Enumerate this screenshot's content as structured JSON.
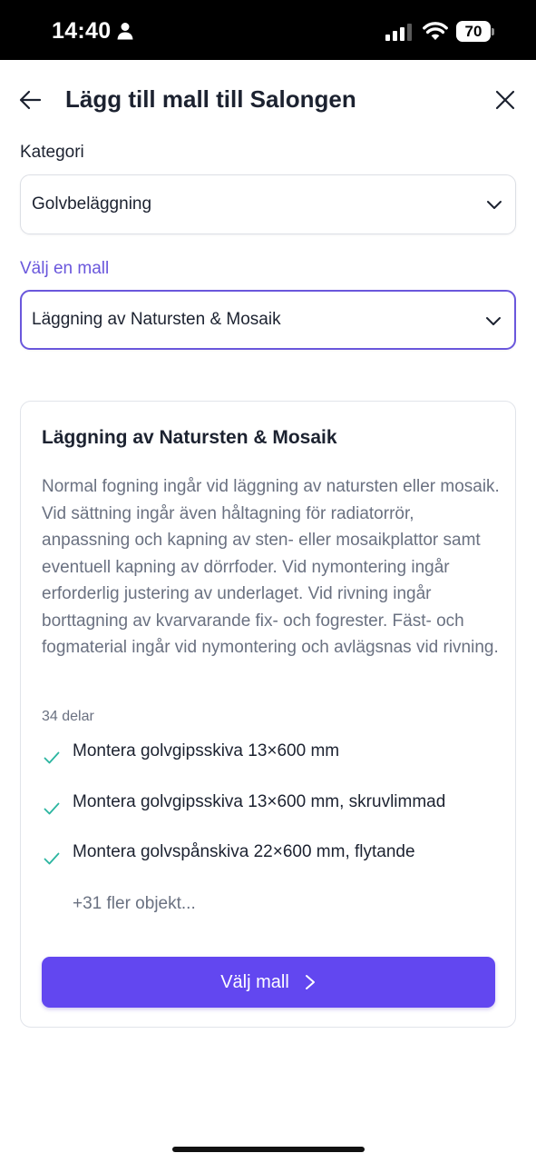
{
  "status_bar": {
    "time": "14:40",
    "battery": "70"
  },
  "header": {
    "title": "Lägg till mall till Salongen"
  },
  "category": {
    "label": "Kategori",
    "value": "Golvbeläggning"
  },
  "template_select": {
    "label": "Välj en mall",
    "value": "Läggning av Natursten & Mosaik"
  },
  "card": {
    "title": "Läggning av Natursten & Mosaik",
    "description": "Normal fogning ingår vid läggning av natursten eller mosaik. Vid sättning ingår även håltagning för radiatorrör, anpassning och kapning av sten- eller mosaikplattor samt eventuell kapning av dörrfoder. Vid nymontering ingår erforderlig justering av underlaget. Vid rivning ingår borttagning av kvarvarande fix- och fogrester. Fäst- och fogmaterial ingår vid nymontering och avlägsnas vid rivning.",
    "parts_count": "34 delar",
    "parts": [
      {
        "label": "Montera golvgipsskiva 13×600 mm"
      },
      {
        "label": "Montera golvgipsskiva 13×600 mm, skruvlimmad"
      },
      {
        "label": "Montera golvspånskiva 22×600 mm, flytande"
      }
    ],
    "more": "+31 fler objekt...",
    "button_label": "Välj mall"
  },
  "colors": {
    "accent": "#6a57dc",
    "button": "#6247f0",
    "check": "#2bb5a0"
  },
  "icons": [
    "person-icon",
    "signal-icon",
    "wifi-icon",
    "back-arrow-icon",
    "close-icon",
    "chevron-down-icon",
    "check-icon",
    "chevron-right-icon"
  ]
}
